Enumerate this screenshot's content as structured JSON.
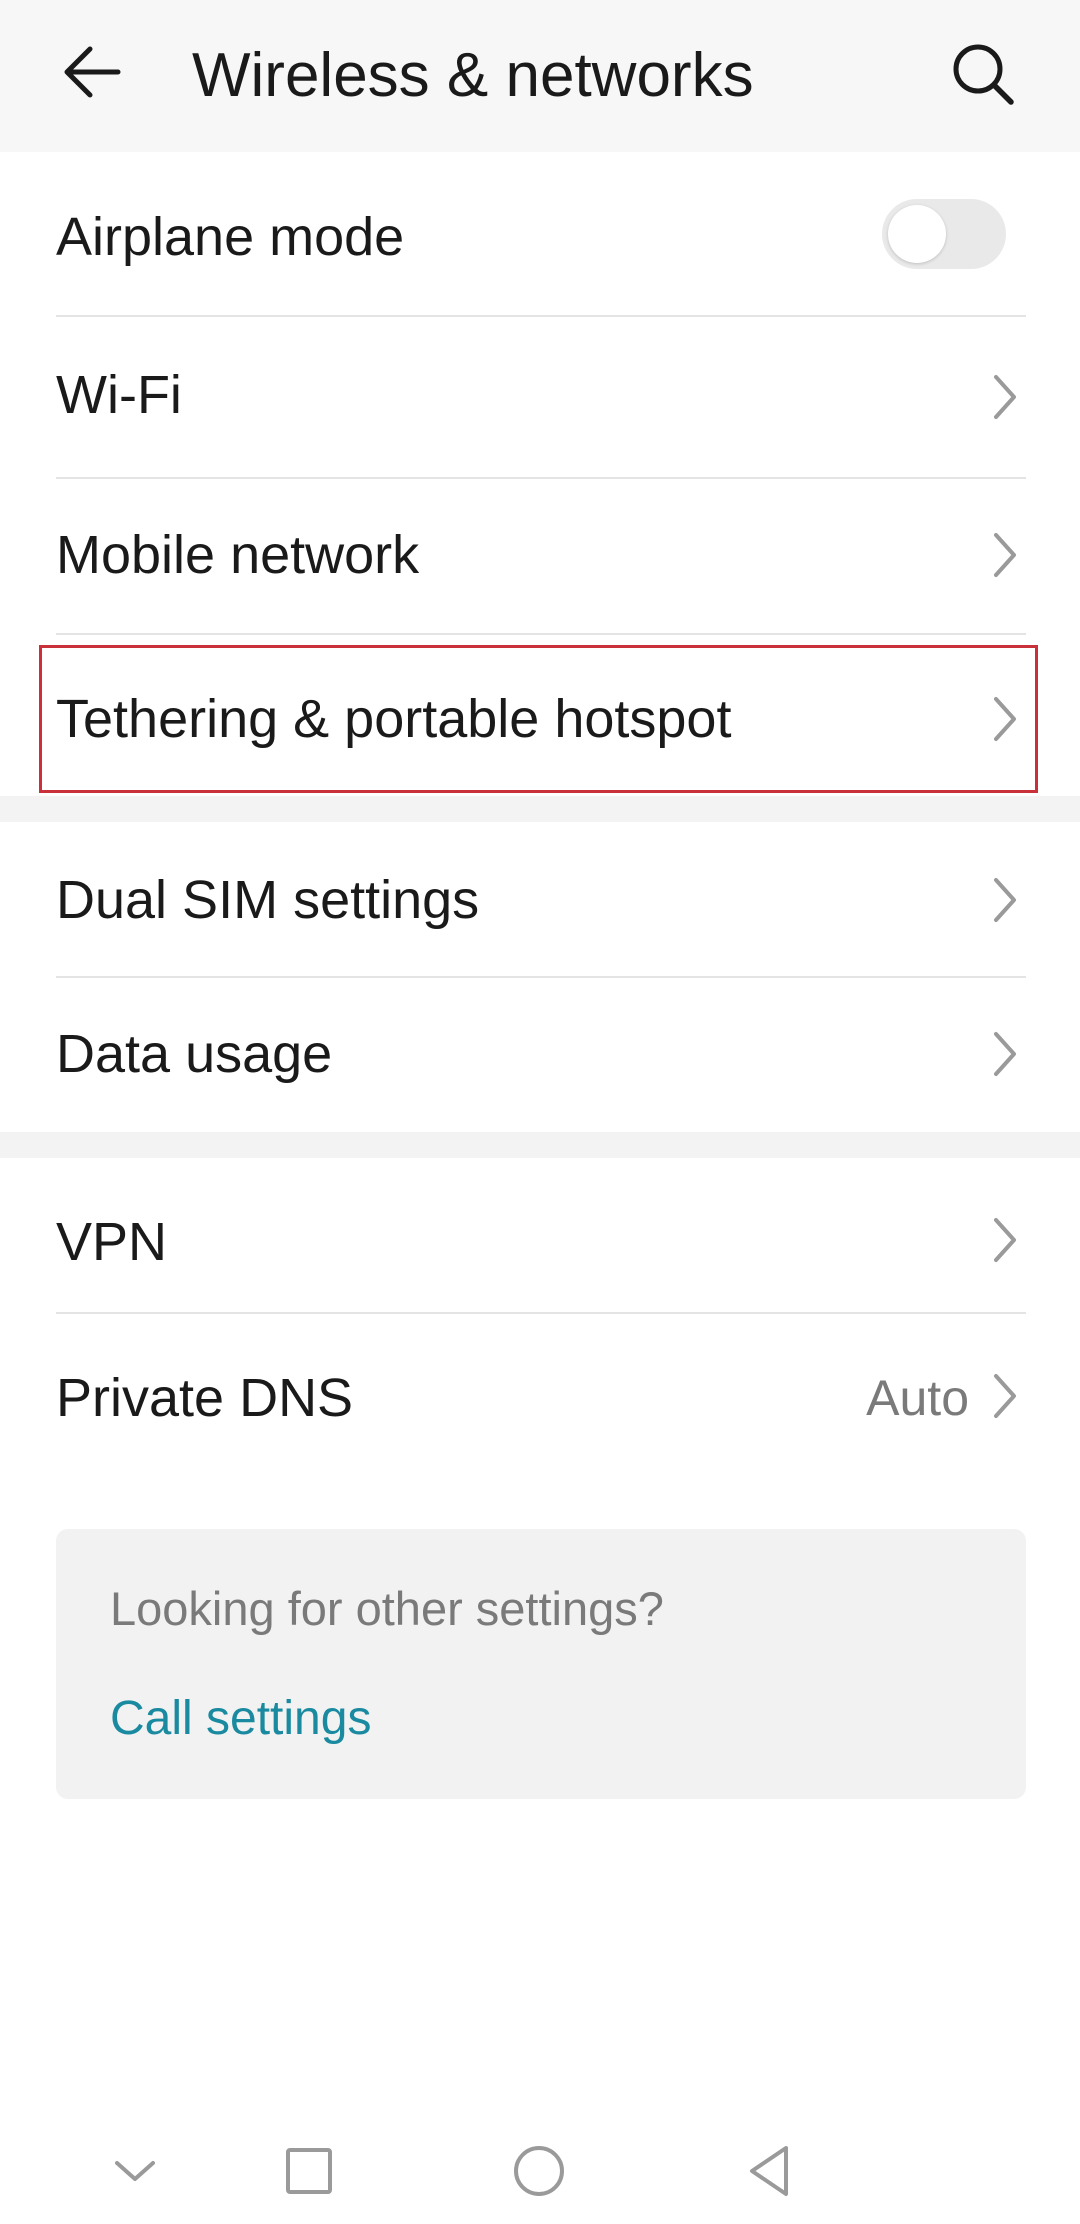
{
  "header": {
    "title": "Wireless & networks",
    "back_icon": "arrow-left-icon",
    "search_icon": "search-icon"
  },
  "settings": {
    "airplane_mode": {
      "label": "Airplane mode",
      "toggle_on": false
    },
    "wifi": {
      "label": "Wi-Fi"
    },
    "mobile_network": {
      "label": "Mobile network"
    },
    "tethering": {
      "label": "Tethering & portable hotspot",
      "highlighted": true
    },
    "dual_sim": {
      "label": "Dual SIM settings"
    },
    "data_usage": {
      "label": "Data usage"
    },
    "vpn": {
      "label": "VPN"
    },
    "private_dns": {
      "label": "Private DNS",
      "value": "Auto"
    }
  },
  "info_card": {
    "hint": "Looking for other settings?",
    "link": "Call settings"
  },
  "nav_bar": {
    "icons": [
      "chevron-down-icon",
      "square-recents-icon",
      "circle-home-icon",
      "triangle-back-icon"
    ]
  },
  "colors": {
    "highlight_border": "#c8313a",
    "link": "#1a8aa0",
    "toggle_off": "#e9e9e9"
  }
}
